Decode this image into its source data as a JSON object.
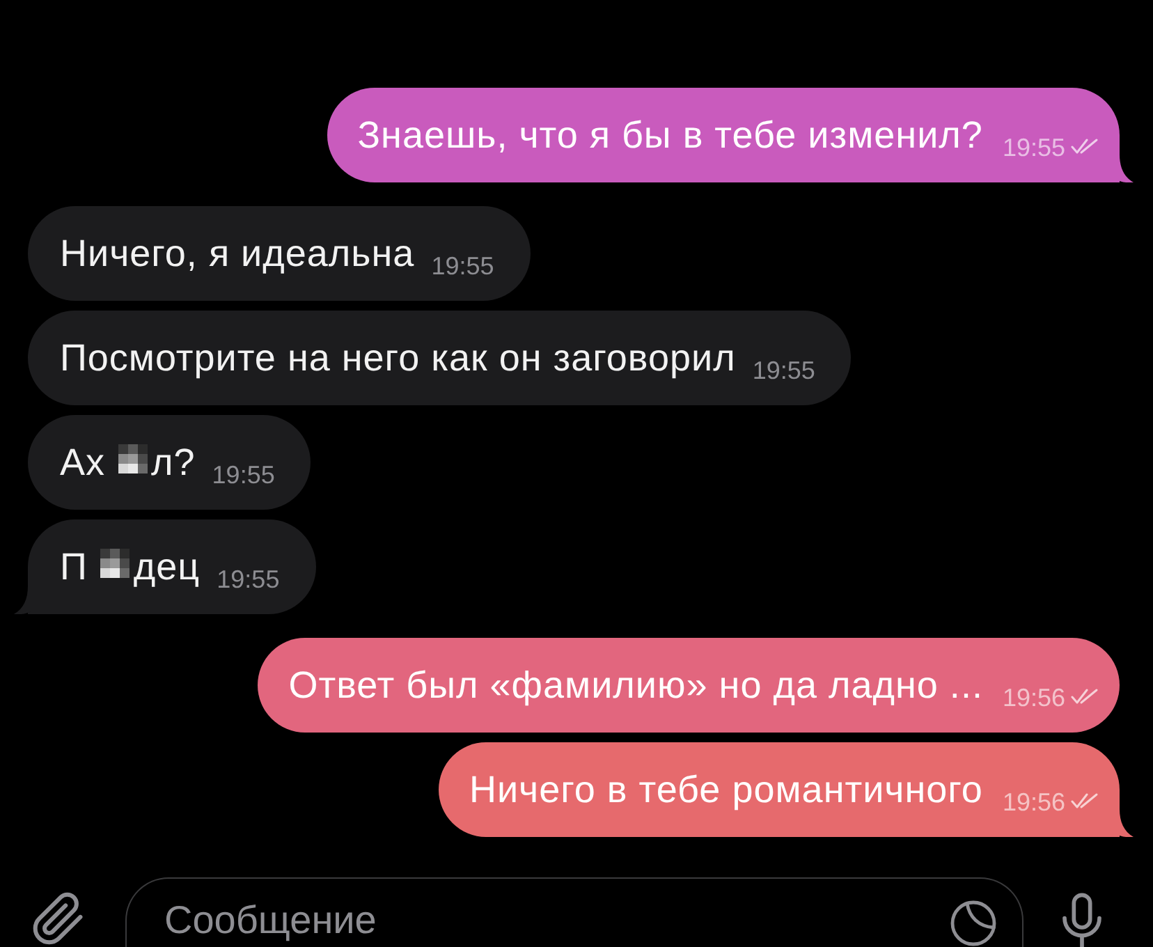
{
  "messages": [
    {
      "kind": "outgoing",
      "text": "Знаешь, что я бы в тебе изменил?",
      "time": "19:55",
      "read": true,
      "tail": true,
      "color": "#c95bbd"
    },
    {
      "kind": "incoming",
      "text": "Ничего, я идеальна",
      "time": "19:55",
      "tail": false
    },
    {
      "kind": "incoming",
      "text": "Посмотрите на него как он заговорил",
      "time": "19:55",
      "tail": false
    },
    {
      "kind": "incoming",
      "parts": [
        {
          "kind": "text",
          "text": "Ах"
        },
        {
          "kind": "censored"
        },
        {
          "kind": "text",
          "text": "л?"
        }
      ],
      "time": "19:55",
      "tail": false
    },
    {
      "kind": "incoming",
      "parts": [
        {
          "kind": "text",
          "text": "П"
        },
        {
          "kind": "censored"
        },
        {
          "kind": "text",
          "text": "дец"
        }
      ],
      "time": "19:55",
      "tail": true
    },
    {
      "kind": "outgoing",
      "text": "Ответ был «фамилию» но да ладно ...",
      "time": "19:56",
      "read": true,
      "tail": false,
      "color": "#e2667e"
    },
    {
      "kind": "outgoing",
      "text": "Ничего в тебе романтичного",
      "time": "19:56",
      "read": true,
      "tail": true,
      "color": "#e66a6d"
    }
  ],
  "composer": {
    "placeholder": "Сообщение"
  }
}
